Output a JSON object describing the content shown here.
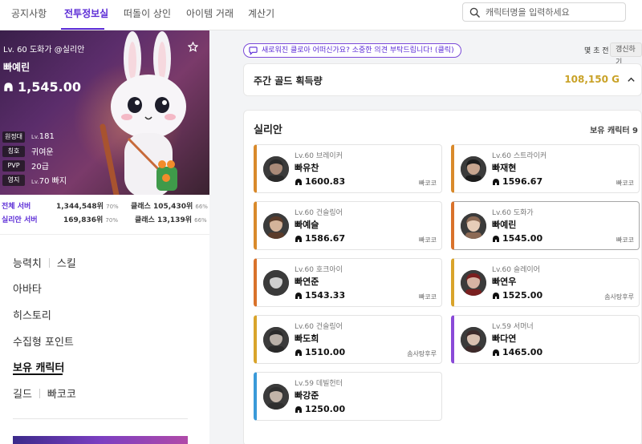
{
  "nav": {
    "items": [
      {
        "label": "공지사항"
      },
      {
        "label": "전투정보실"
      },
      {
        "label": "떠돌이 상인"
      },
      {
        "label": "아이템 거래"
      },
      {
        "label": "계산기"
      }
    ],
    "active_index": 1
  },
  "search": {
    "placeholder": "캐릭터명을 입력하세요",
    "value": "",
    "icon": "search-icon"
  },
  "profile": {
    "level_line": "Lv. 60 도화가 @실리안",
    "name": "빠예린",
    "score": "1,545.00",
    "stats": [
      {
        "tag": "원정대",
        "value_prefix": "Lv.",
        "value": "181"
      },
      {
        "tag": "칭호",
        "value_prefix": "",
        "value": "귀여운"
      },
      {
        "tag": "PVP",
        "value_prefix": "",
        "value": "20급"
      },
      {
        "tag": "영지",
        "value_prefix": "Lv.",
        "value": "70 빠지"
      }
    ]
  },
  "rankings": [
    {
      "label": "전체 서버",
      "rank": "1,344,548위",
      "rank_pct": "70%",
      "class_label": "클래스 105,430위",
      "class_pct": "66%"
    },
    {
      "label": "실리안 서버",
      "rank": "169,836위",
      "rank_pct": "70%",
      "class_label": "클래스 13,139위",
      "class_pct": "66%"
    }
  ],
  "side_menu": {
    "stats": "능력치",
    "skills": "스킬",
    "avatar": "아바타",
    "history": "히스토리",
    "collectibles": "수집형 포인트",
    "owned_characters": "보유 캐릭터",
    "guild_label": "길드",
    "guild_name": "빠코코"
  },
  "banner": {
    "feedback": "새로워진 클로아 어떠신가요? 소중한 의견 부탁드립니다! (클릭)",
    "update_time": "몇 초 전",
    "refresh": "갱신하기"
  },
  "gold": {
    "title": "주간 골드 획득량",
    "amount": "108,150 G"
  },
  "characters_panel": {
    "server": "실리안",
    "count_label": "보유 캐릭터",
    "count": "9"
  },
  "characters": [
    {
      "level": "Lv.60 브레이커",
      "name": "빠유찬",
      "score": "1600.83",
      "guild": "빠코코",
      "accent": "#d98a2b",
      "avatar_palette": [
        "#2a2a2a",
        "#a98a78"
      ]
    },
    {
      "level": "Lv.60 스트라이커",
      "name": "빠재현",
      "score": "1596.67",
      "guild": "빠코코",
      "accent": "#d98a2b",
      "avatar_palette": [
        "#1c1c1c",
        "#c7a58f"
      ]
    },
    {
      "level": "Lv.60 건슬링어",
      "name": "빠예슬",
      "score": "1586.67",
      "guild": "빠코코",
      "accent": "#d98a2b",
      "avatar_palette": [
        "#5a3b2a",
        "#d4b39a"
      ]
    },
    {
      "level": "Lv.60 도화가",
      "name": "빠예린",
      "score": "1545.00",
      "guild": "빠코코",
      "accent": "#d9722b",
      "avatar_palette": [
        "#8c6a55",
        "#e7cdb8"
      ]
    },
    {
      "level": "Lv.60 호크아이",
      "name": "빠연준",
      "score": "1543.33",
      "guild": "빠코코",
      "accent": "#d9722b",
      "avatar_palette": [
        "#3a3a3a",
        "#cfcfcf"
      ]
    },
    {
      "level": "Lv.60 슬레이어",
      "name": "빠연우",
      "score": "1525.00",
      "guild": "솜사탕후루",
      "accent": "#d9a42b",
      "avatar_palette": [
        "#7a1f1f",
        "#d6b3a3"
      ]
    },
    {
      "level": "Lv.60 건슬링어",
      "name": "빠도희",
      "score": "1510.00",
      "guild": "솜사탕후루",
      "accent": "#d9a42b",
      "avatar_palette": [
        "#2a2a2a",
        "#b9b0a8"
      ]
    },
    {
      "level": "Lv.59 서머너",
      "name": "빠다연",
      "score": "1465.00",
      "guild": "",
      "accent": "#8a4ad8",
      "avatar_palette": [
        "#3d2a2a",
        "#d9c0b0"
      ]
    },
    {
      "level": "Lv.59 데빌헌터",
      "name": "빠강준",
      "score": "1250.00",
      "guild": "",
      "accent": "#3a9ad9",
      "avatar_palette": [
        "#2f2f2f",
        "#c2b4a8"
      ]
    }
  ],
  "selected_character": "빠예린",
  "colors": {
    "brand": "#5b2bd6",
    "gold": "#c9a227"
  }
}
